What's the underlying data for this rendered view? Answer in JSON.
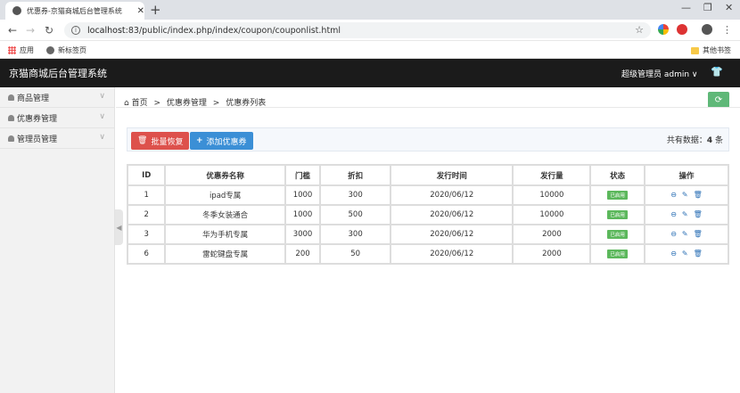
{
  "browser": {
    "tab_title": "优惠券-京猫商城后台管理系统",
    "url_host": "localhost",
    "url_rest": ":83/public/index.php/index/coupon/couponlist.html",
    "bookmarks": {
      "apps": "应用",
      "new_tab": "新标签页",
      "other": "其他书签"
    }
  },
  "header": {
    "brand": "京猫商城后台管理系统",
    "user": "超级管理员  admin ∨"
  },
  "sidebar": {
    "items": [
      {
        "label": "商品管理"
      },
      {
        "label": "优惠券管理"
      },
      {
        "label": "管理员管理"
      }
    ]
  },
  "breadcrumb": {
    "home": "首页",
    "sep": ">",
    "level1": "优惠券管理",
    "level2": "优惠券列表"
  },
  "toolbar": {
    "batch_restore": "批量恢复",
    "add_coupon": "添加优惠券",
    "total_label": "共有数据：",
    "total_count": "4",
    "total_unit": "条"
  },
  "table": {
    "headers": [
      "ID",
      "优惠券名称",
      "门槛",
      "折扣",
      "发行时间",
      "发行量",
      "状态",
      "操作"
    ],
    "rows": [
      {
        "id": "1",
        "name": "ipad专属",
        "threshold": "1000",
        "discount": "300",
        "date": "2020/06/12",
        "qty": "10000",
        "status": "已启用"
      },
      {
        "id": "2",
        "name": "冬季女装通合",
        "threshold": "1000",
        "discount": "500",
        "date": "2020/06/12",
        "qty": "10000",
        "status": "已启用"
      },
      {
        "id": "3",
        "name": "华为手机专属",
        "threshold": "3000",
        "discount": "300",
        "date": "2020/06/12",
        "qty": "2000",
        "status": "已启用"
      },
      {
        "id": "6",
        "name": "雷蛇键盘专属",
        "threshold": "200",
        "discount": "50",
        "date": "2020/06/12",
        "qty": "2000",
        "status": "已启用"
      }
    ]
  },
  "colors": {
    "header_bg": "#1b1b1b",
    "btn_red": "#dd514c",
    "btn_blue": "#3b8fd6",
    "status_green": "#5cb85c",
    "refresh_green": "#5fb878"
  }
}
